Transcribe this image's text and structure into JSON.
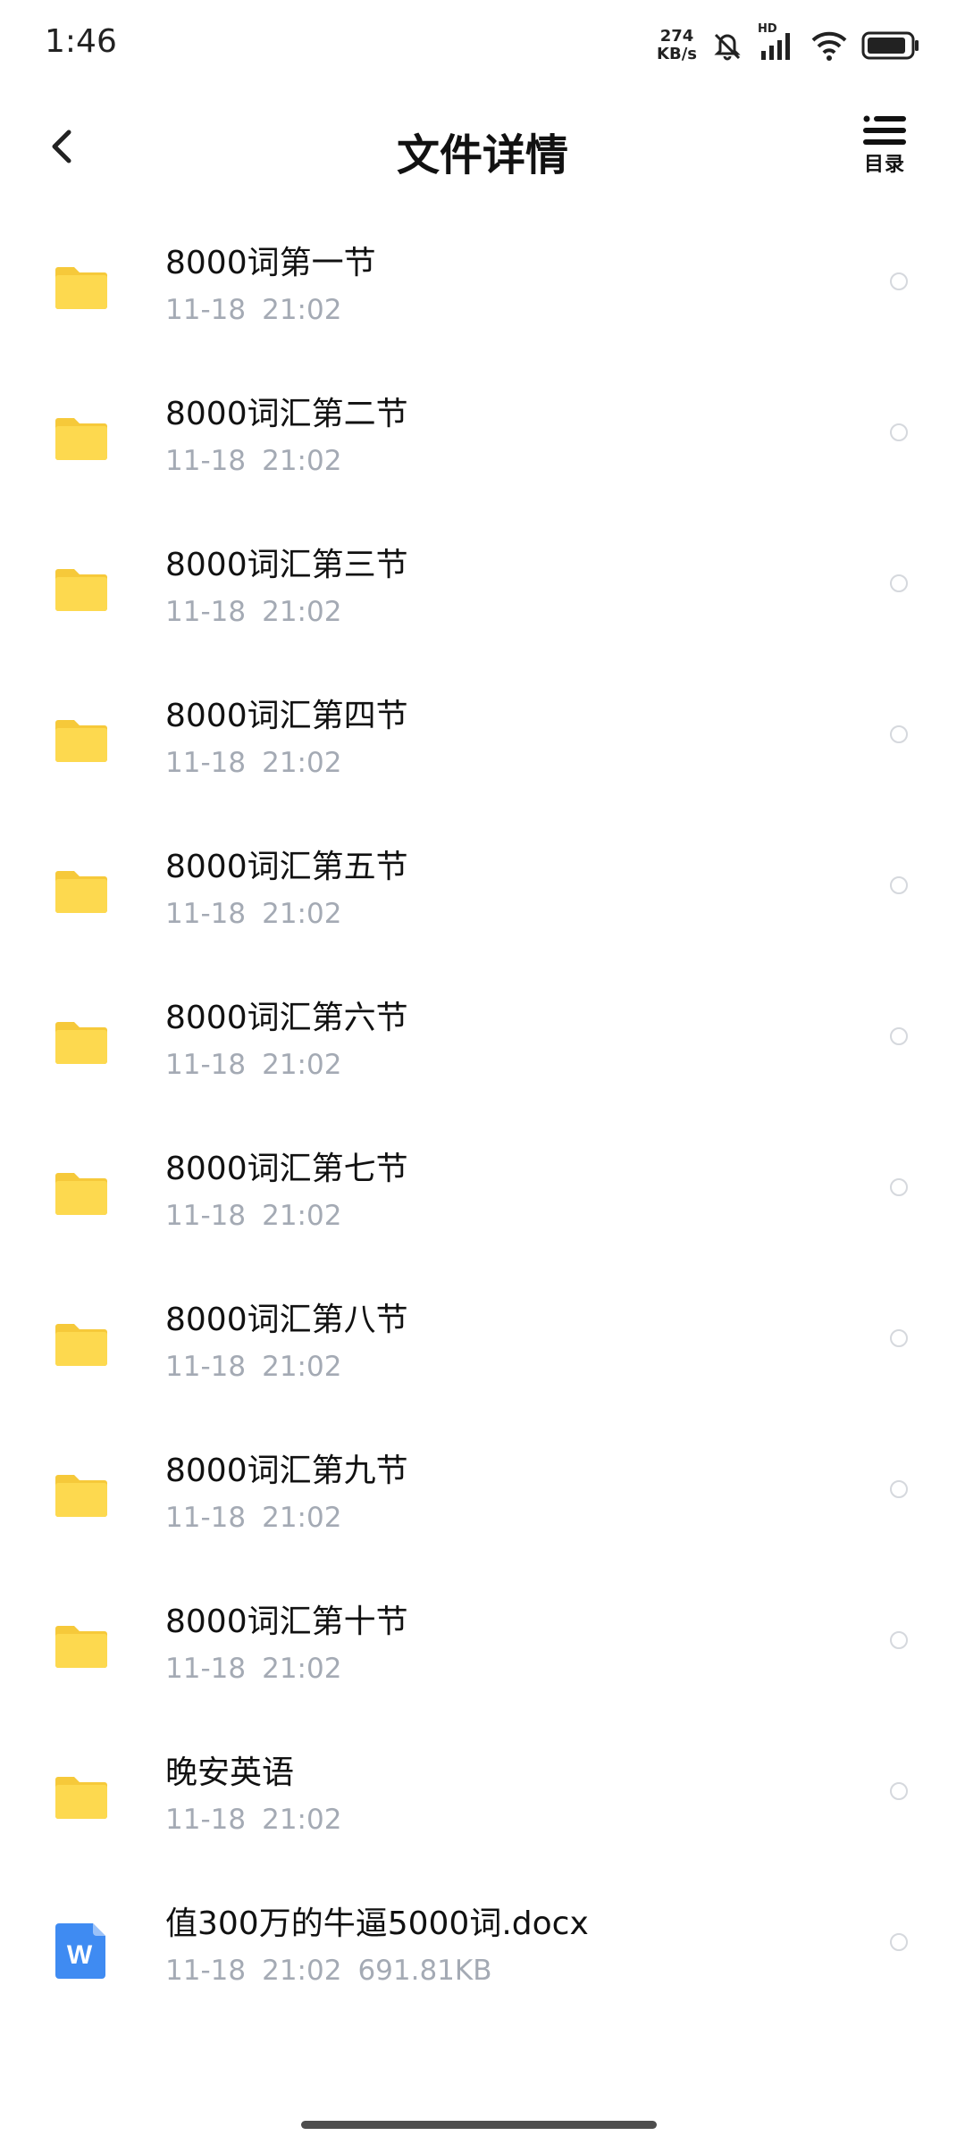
{
  "status_bar": {
    "time": "1:46",
    "net_speed_value": "274",
    "net_speed_unit": "KB/s",
    "network_label": "HD",
    "icons": [
      "mute-icon",
      "signal-icon",
      "wifi-icon",
      "battery-icon"
    ]
  },
  "header": {
    "title": "文件详情",
    "back_icon": "chevron-left-icon",
    "toc_label": "目录"
  },
  "files": [
    {
      "name": "8000词第一节",
      "date": "11-18",
      "time": "21:02",
      "size": "",
      "type": "folder"
    },
    {
      "name": "8000词汇第二节",
      "date": "11-18",
      "time": "21:02",
      "size": "",
      "type": "folder"
    },
    {
      "name": "8000词汇第三节",
      "date": "11-18",
      "time": "21:02",
      "size": "",
      "type": "folder"
    },
    {
      "name": "8000词汇第四节",
      "date": "11-18",
      "time": "21:02",
      "size": "",
      "type": "folder"
    },
    {
      "name": "8000词汇第五节",
      "date": "11-18",
      "time": "21:02",
      "size": "",
      "type": "folder"
    },
    {
      "name": "8000词汇第六节",
      "date": "11-18",
      "time": "21:02",
      "size": "",
      "type": "folder"
    },
    {
      "name": "8000词汇第七节",
      "date": "11-18",
      "time": "21:02",
      "size": "",
      "type": "folder"
    },
    {
      "name": "8000词汇第八节",
      "date": "11-18",
      "time": "21:02",
      "size": "",
      "type": "folder"
    },
    {
      "name": "8000词汇第九节",
      "date": "11-18",
      "time": "21:02",
      "size": "",
      "type": "folder"
    },
    {
      "name": "8000词汇第十节",
      "date": "11-18",
      "time": "21:02",
      "size": "",
      "type": "folder"
    },
    {
      "name": "晚安英语",
      "date": "11-18",
      "time": "21:02",
      "size": "",
      "type": "folder"
    },
    {
      "name": "值300万的牛逼5000词.docx",
      "date": "11-18",
      "time": "21:02",
      "size": "691.81KB",
      "type": "docx",
      "icon_letter": "W"
    }
  ],
  "colors": {
    "folder": "#fdd94f",
    "folder_tab": "#f6c93a",
    "word": "#3f8bf2",
    "meta_text": "#a4aab4"
  }
}
